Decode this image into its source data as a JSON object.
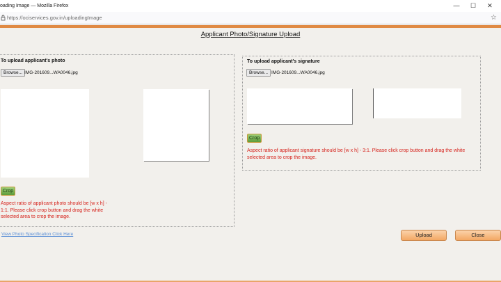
{
  "window": {
    "title": "oading Image — Mozilla Firefox",
    "minimize_glyph": "—",
    "maximize_glyph": "☐",
    "close_glyph": "✕"
  },
  "browser": {
    "url": "https://ociservices.gov.in/uploadingImage",
    "lock_icon": "lock-icon",
    "star_icon": "bookmark-star-icon"
  },
  "page": {
    "title": "Applicant Photo/Signature Upload"
  },
  "photo": {
    "heading": "To upload applicant's photo",
    "browse_label": "Browse...",
    "file_name": "IMG-201609...WA0046.jpg",
    "crop_label": "Crop",
    "aspect_msg": "Aspect ratio of applicant photo should be [w x h] - 1:1. Please click crop button and drag the white selected area to crop the image."
  },
  "signature": {
    "heading": "To upload applicant's signature",
    "browse_label": "Browse...",
    "file_name": "IMG-201609...WA0046.jpg",
    "crop_label": "Crop",
    "aspect_msg": "Aspect ratio of applicant signature should be [w x h] - 3:1. Please click crop button and drag the white selected area to crop the image."
  },
  "footer": {
    "spec_link": "View Photo Specification Click Here",
    "upload_label": "Upload",
    "close_label": "Close"
  },
  "colors": {
    "accent_orange": "#e08a44",
    "error_red": "#d6221b",
    "link_blue": "#5b8fd6",
    "crop_green": "#5d9c3a"
  }
}
